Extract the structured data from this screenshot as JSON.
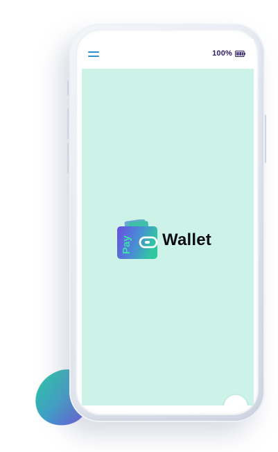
{
  "status_bar": {
    "battery_percent": "100%",
    "menu_icon": "hamburger-menu-icon",
    "battery_icon": "battery-full-icon"
  },
  "splash": {
    "logo_badge_text": "Pay",
    "logo_word": "Wallet",
    "logo_icon": "wallet-icon"
  },
  "colors": {
    "screen_background": "#cdf3e8",
    "status_bar_background": "#ffffff",
    "menu_icon": "#2a8fd0",
    "battery_text": "#2b1a64",
    "logo_gradient_start": "#6a4de0",
    "logo_gradient_end": "#2fc7a0",
    "logo_word": "#0c0c14"
  },
  "floating_button": {
    "icon": "circle-button"
  }
}
